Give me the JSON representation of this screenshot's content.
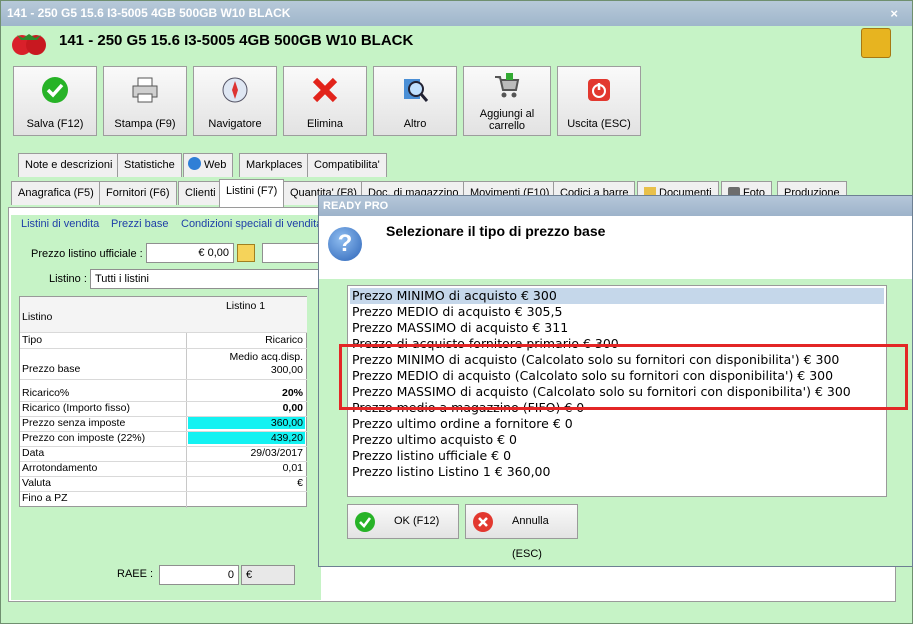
{
  "window": {
    "titlebar": "141 - 250 G5 15.6 I3-5005 4GB 500GB W10 BLACK",
    "header_title": "141 - 250 G5 15.6 I3-5005 4GB 500GB W10 BLACK",
    "close_glyph": "×"
  },
  "toolbar": [
    {
      "label": "Salva (F12)",
      "icon": "check-icon"
    },
    {
      "label": "Stampa (F9)",
      "icon": "printer-icon"
    },
    {
      "label": "Navigatore",
      "icon": "compass-icon"
    },
    {
      "label": "Elimina",
      "icon": "delete-x-icon"
    },
    {
      "label": "Altro",
      "icon": "magnifier-icon"
    },
    {
      "label": "Aggiungi al carrello",
      "icon": "cart-icon"
    },
    {
      "label": "Uscita (ESC)",
      "icon": "power-icon"
    }
  ],
  "tabs_row1": [
    "Note e descrizioni",
    "Statistiche",
    "Web",
    "Markplaces",
    "Compatibilita'"
  ],
  "tabs_row2": [
    "Anagrafica (F5)",
    "Fornitori (F6)",
    "Clienti",
    "Listini (F7)",
    "Quantita' (F8)",
    "Doc. di magazzino",
    "Movimenti (F10)",
    "Codici a barre",
    "Documenti",
    "Foto",
    "Produzione"
  ],
  "subtabs": [
    "Listini di vendita",
    "Prezzi base",
    "Condizioni speciali di vendita"
  ],
  "form": {
    "prezzo_label": "Prezzo listino ufficiale :",
    "prezzo_value": "€ 0,00",
    "listino_label": "Listino :",
    "listino_value": "Tutti i listini",
    "raee_label": "RAEE :",
    "raee_value": "0",
    "raee_currency": "€"
  },
  "grid": {
    "header_left": "Listino",
    "header_right": "Listino 1",
    "rows": [
      {
        "label": "Tipo",
        "value": "Ricarico"
      },
      {
        "label": "Prezzo base",
        "value": "Medio acq.disp.",
        "value2": "300,00"
      },
      {
        "label": "Ricarico%",
        "value": "20%"
      },
      {
        "label": "Ricarico (Importo fisso)",
        "value": "0,00"
      },
      {
        "label": "Prezzo senza imposte",
        "value": "360,00"
      },
      {
        "label": "Prezzo con imposte (22%)",
        "value": "439,20"
      },
      {
        "label": "Data",
        "value": "29/03/2017"
      },
      {
        "label": "Arrotondamento",
        "value": "0,01"
      },
      {
        "label": "Valuta",
        "value": "€"
      },
      {
        "label": "Fino a PZ",
        "value": ""
      }
    ]
  },
  "dialog": {
    "title": "READY PRO",
    "message": "Selezionare il tipo di prezzo base",
    "options": [
      "Prezzo MINIMO di acquisto € 300",
      "Prezzo MEDIO di acquisto € 305,5",
      "Prezzo MASSIMO di acquisto € 311",
      "Prezzo di acquisto fornitore primario € 300",
      "Prezzo MINIMO di acquisto (Calcolato solo su fornitori con disponibilita') € 300",
      "Prezzo MEDIO di acquisto (Calcolato solo su fornitori con disponibilita') € 300",
      "Prezzo MASSIMO di acquisto (Calcolato solo su fornitori con disponibilita') € 300",
      "Prezzo medio a magazzino (FIFO) € 0",
      "Prezzo ultimo ordine a fornitore € 0",
      "Prezzo ultimo acquisto € 0",
      "Prezzo listino ufficiale € 0",
      "Prezzo listino Listino 1 € 360,00"
    ],
    "ok_label": "OK (F12)",
    "cancel_label": "Annulla (ESC)"
  },
  "colors": {
    "accent_green": "#c6f3c6",
    "highlight": "#e32626",
    "cyan": "#13f2f2"
  }
}
